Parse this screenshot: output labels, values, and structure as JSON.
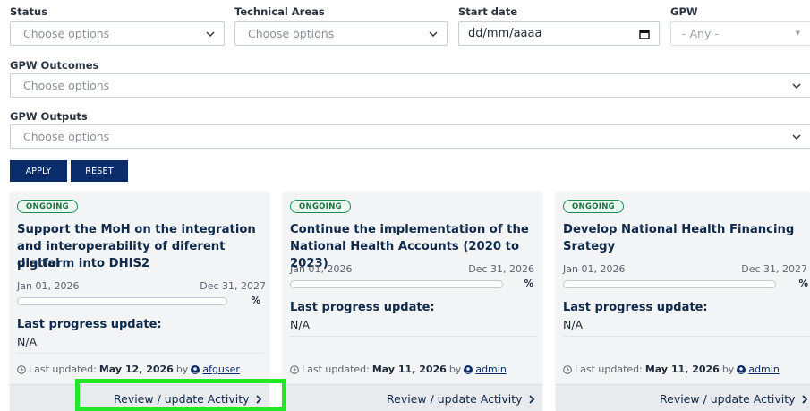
{
  "filters": {
    "status": {
      "label": "Status",
      "placeholder": "Choose options"
    },
    "technical_areas": {
      "label": "Technical Areas",
      "placeholder": "Choose options"
    },
    "start_date": {
      "label": "Start date",
      "value": "dd/mm/aaaa"
    },
    "gpw": {
      "label": "GPW",
      "value": "- Any -"
    },
    "gpw_outcomes": {
      "label": "GPW Outcomes",
      "placeholder": "Choose options"
    },
    "gpw_outputs": {
      "label": "GPW Outputs",
      "placeholder": "Choose options"
    }
  },
  "buttons": {
    "apply": "APPLY",
    "reset": "RESET"
  },
  "cards": [
    {
      "status": "ONGOING",
      "title_lines": [
        "Support the MoH on the integration",
        "and interoperability of diferent digital",
        "platform into DHIS2"
      ],
      "start_date": "Jan 01, 2026",
      "end_date": "Dec 31, 2027",
      "progress_percent": 0,
      "percent_suffix": "%",
      "lpu_label": "Last progress update:",
      "lpu_value": "N/A",
      "updated_prefix": "Last updated:",
      "updated_date": "May 12, 2026",
      "updated_by": "by",
      "updated_user": "afguser",
      "review_label": "Review / update Activity"
    },
    {
      "status": "ONGOING",
      "title_lines": [
        "Continue the implementation of the",
        "National Health Accounts (2020 to 2023)"
      ],
      "start_date": "Jan 01, 2026",
      "end_date": "Dec 31, 2026",
      "progress_percent": 0,
      "percent_suffix": "%",
      "lpu_label": "Last progress update:",
      "lpu_value": "N/A",
      "updated_prefix": "Last updated:",
      "updated_date": "May 11, 2026",
      "updated_by": "by",
      "updated_user": "admin",
      "review_label": "Review / update Activity"
    },
    {
      "status": "ONGOING",
      "title_lines": [
        "Develop National Health Financing",
        "Srategy"
      ],
      "start_date": "Jan 01, 2026",
      "end_date": "Dec 31, 2027",
      "progress_percent": 0,
      "percent_suffix": "%",
      "lpu_label": "Last progress update:",
      "lpu_value": "N/A",
      "updated_prefix": "Last updated:",
      "updated_date": "May 11, 2026",
      "updated_by": "by",
      "updated_user": "admin",
      "review_label": "Review / update Activity"
    }
  ],
  "colors": {
    "primary": "#0a2c6b",
    "badge_border": "#1e8b52",
    "highlight": "#22e62a"
  }
}
